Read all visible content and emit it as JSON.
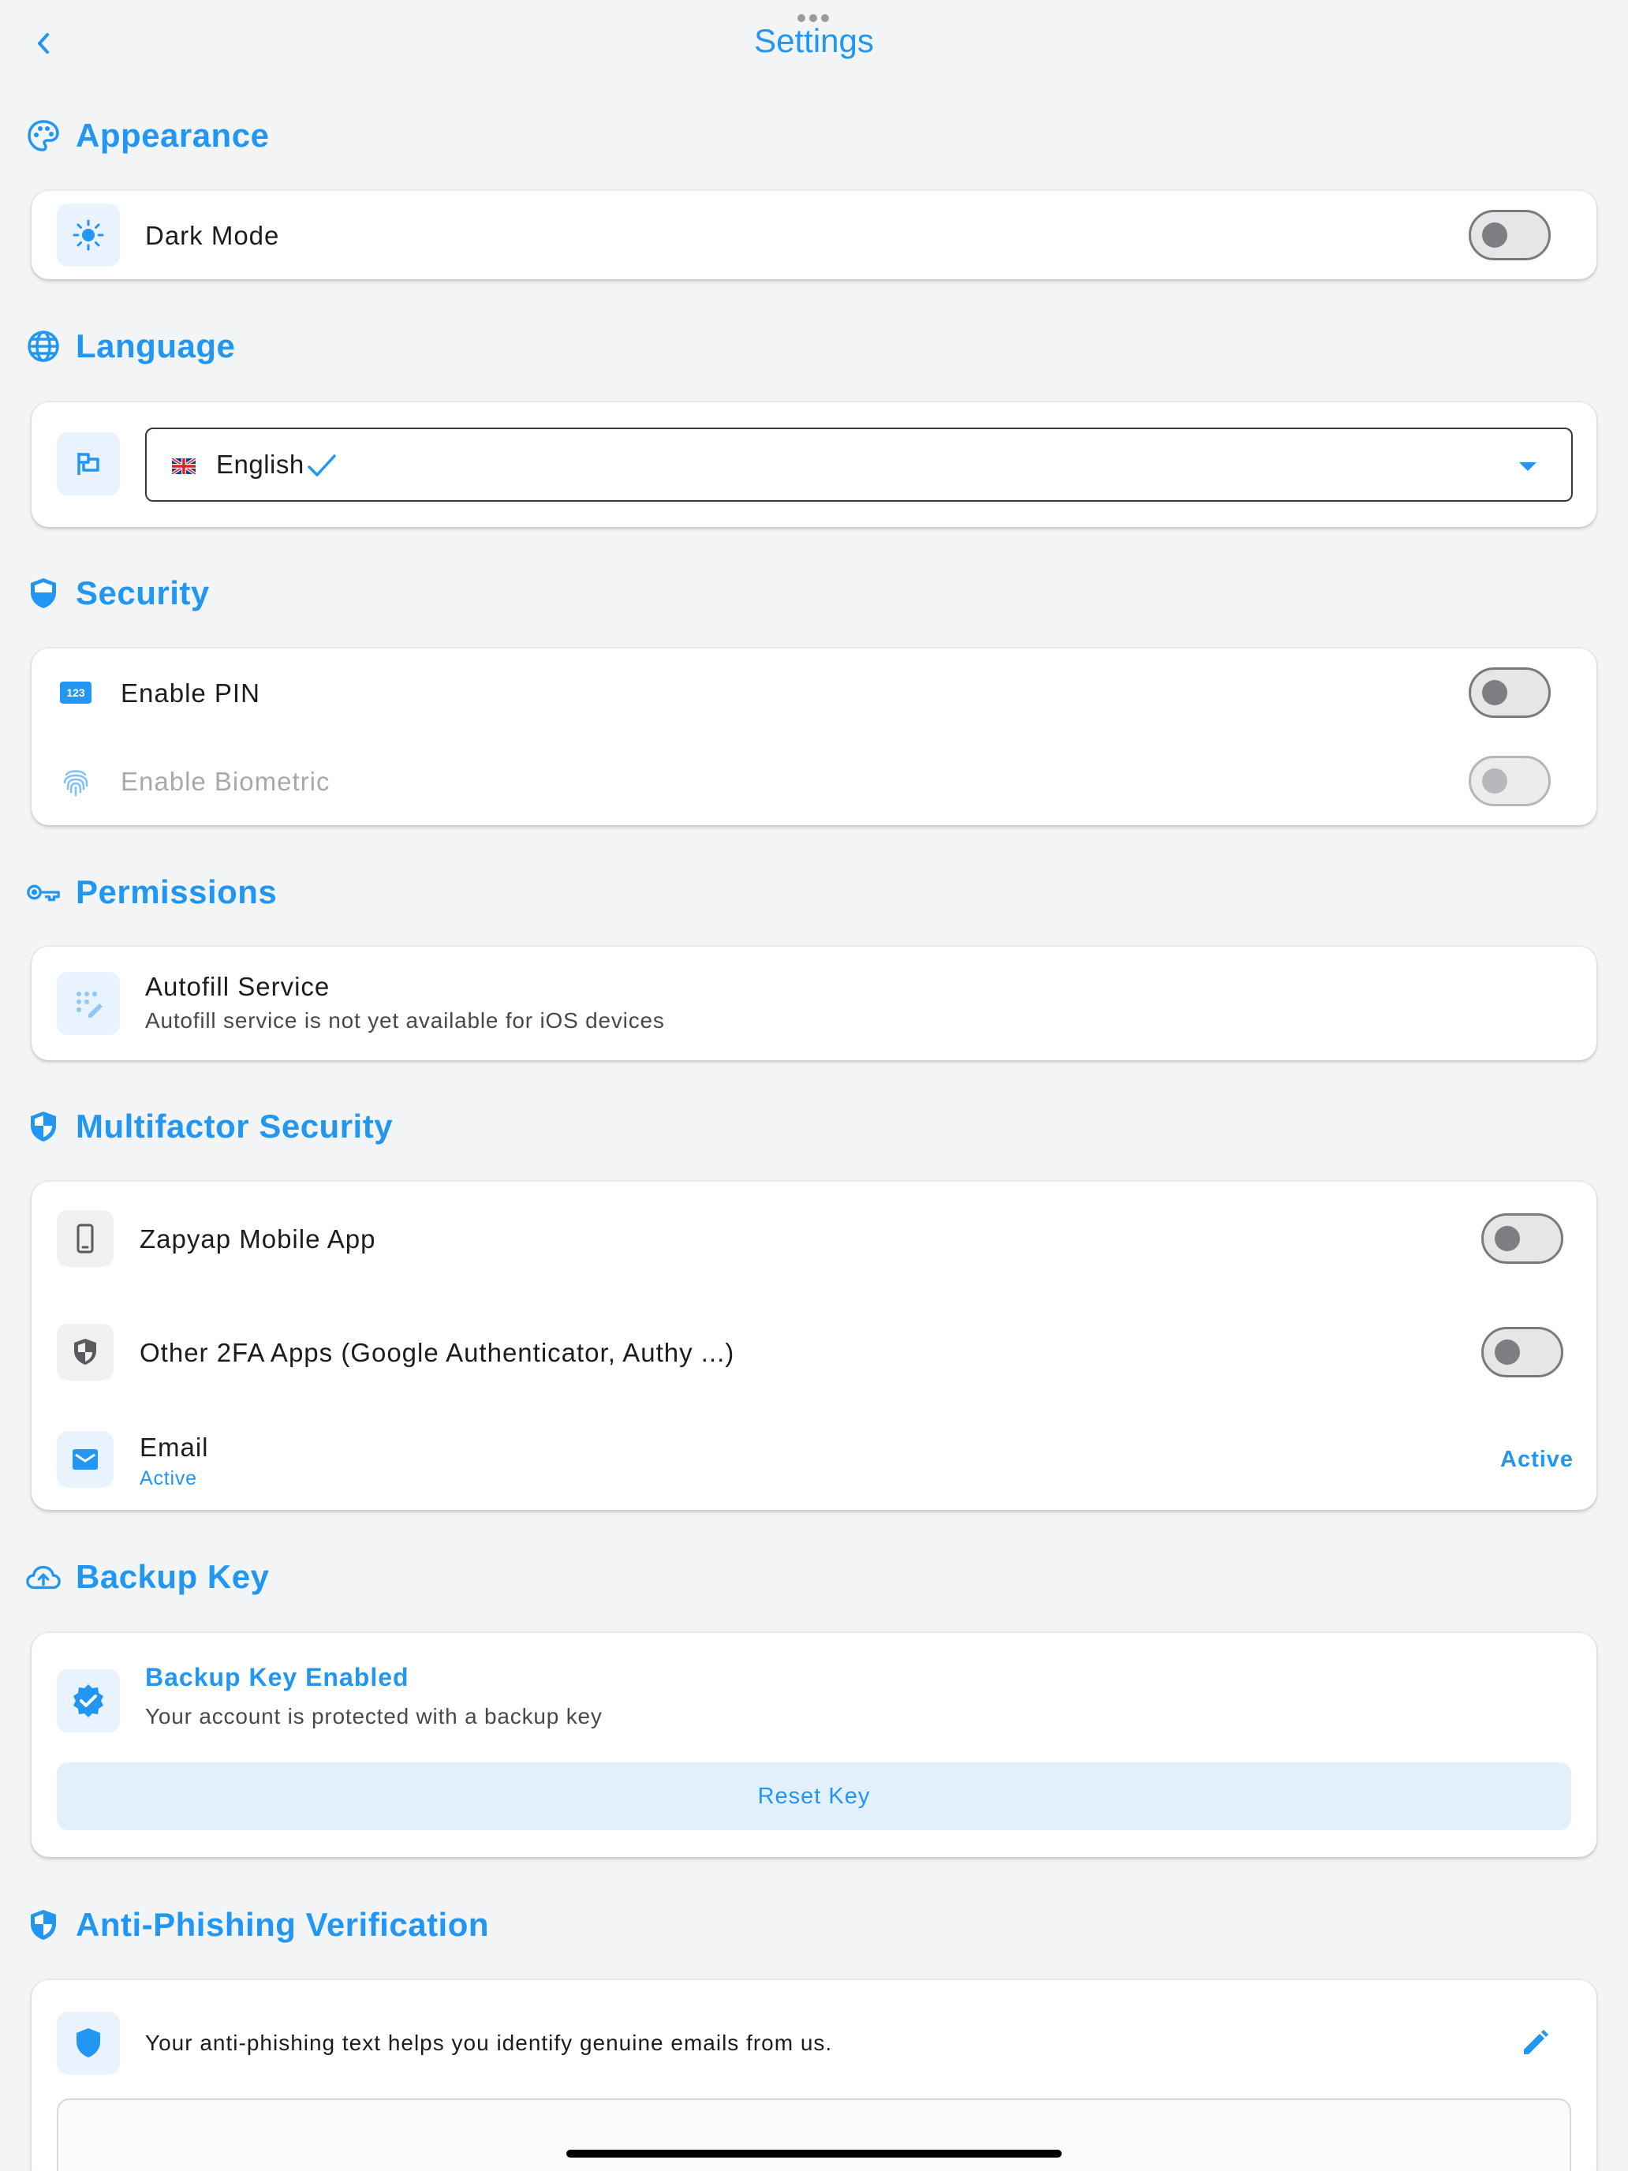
{
  "header": {
    "title": "Settings"
  },
  "appearance": {
    "title": "Appearance",
    "dark_mode_label": "Dark Mode",
    "dark_mode_on": false
  },
  "language": {
    "title": "Language",
    "selected": "English",
    "flag": "uk-flag"
  },
  "security": {
    "title": "Security",
    "pin_label": "Enable PIN",
    "biometric_label": "Enable Biometric"
  },
  "permissions": {
    "title": "Permissions",
    "autofill_label": "Autofill Service",
    "autofill_sub": "Autofill service is not yet available for iOS devices"
  },
  "multifactor": {
    "title": "Multifactor Security",
    "items": [
      {
        "label": "Zapyap Mobile App"
      },
      {
        "label": "Other 2FA Apps (Google Authenticator, Authy ...)"
      },
      {
        "label": "Email",
        "sub": "Active",
        "action": "Active"
      }
    ]
  },
  "backup": {
    "title": "Backup Key",
    "status_title": "Backup Key Enabled",
    "status_sub": "Your account is protected with a backup key",
    "reset_label": "Reset Key"
  },
  "anti_phishing": {
    "title": "Anti-Phishing Verification",
    "description": "Your anti-phishing text helps you identify genuine emails from us."
  },
  "colors": {
    "accent": "#2196f3",
    "background": "#f3f4f5",
    "card": "#ffffff"
  }
}
